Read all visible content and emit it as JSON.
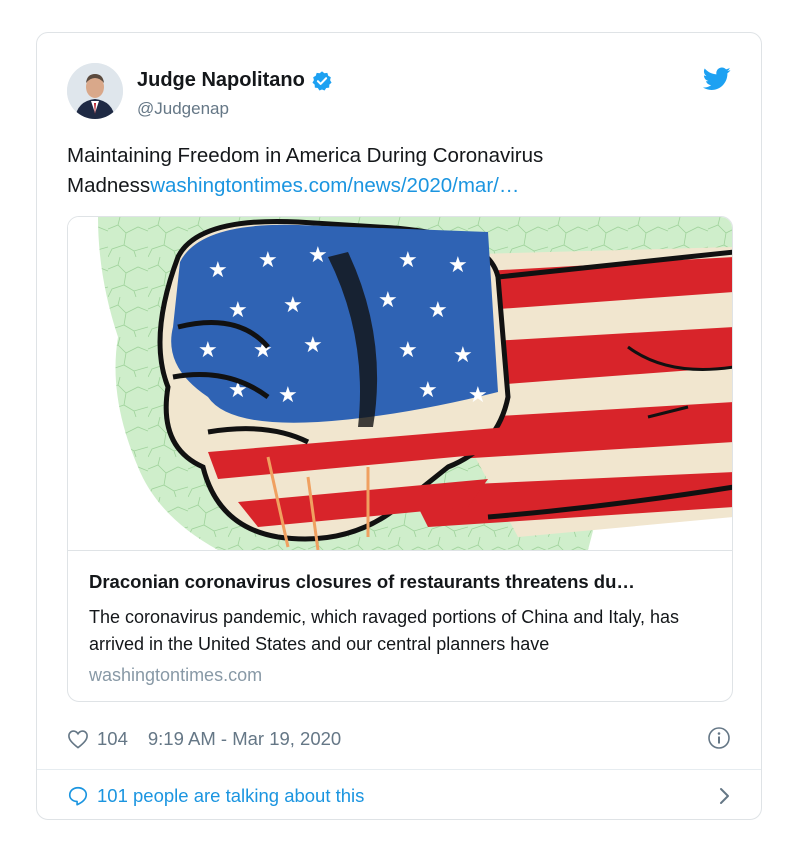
{
  "author": {
    "display_name": "Judge Napolitano",
    "handle": "@Judgenap"
  },
  "tweet": {
    "text": "Maintaining Freedom in America During Coronavirus Madness",
    "link_text": "washingtontimes.com/news/2020/mar/…"
  },
  "link_card": {
    "title": "Draconian coronavirus closures of restaurants threatens du…",
    "description": "The coronavirus pandemic, which ravaged portions of China and Italy, has arrived in the United States and our central planners have",
    "domain": "washingtontimes.com"
  },
  "meta": {
    "likes": "104",
    "timestamp": "9:19 AM - Mar 19, 2020"
  },
  "footer": {
    "conversation": "101 people are talking about this"
  },
  "icons": {
    "verified": "verified-badge-icon",
    "brand": "twitter-bird-icon",
    "like": "heart-icon",
    "info": "info-icon",
    "reply": "speech-bubble-icon",
    "chevron": "chevron-right-icon"
  },
  "colors": {
    "brand_blue": "#1da1f2",
    "link_blue": "#1b95e0",
    "secondary_text": "#657786"
  }
}
